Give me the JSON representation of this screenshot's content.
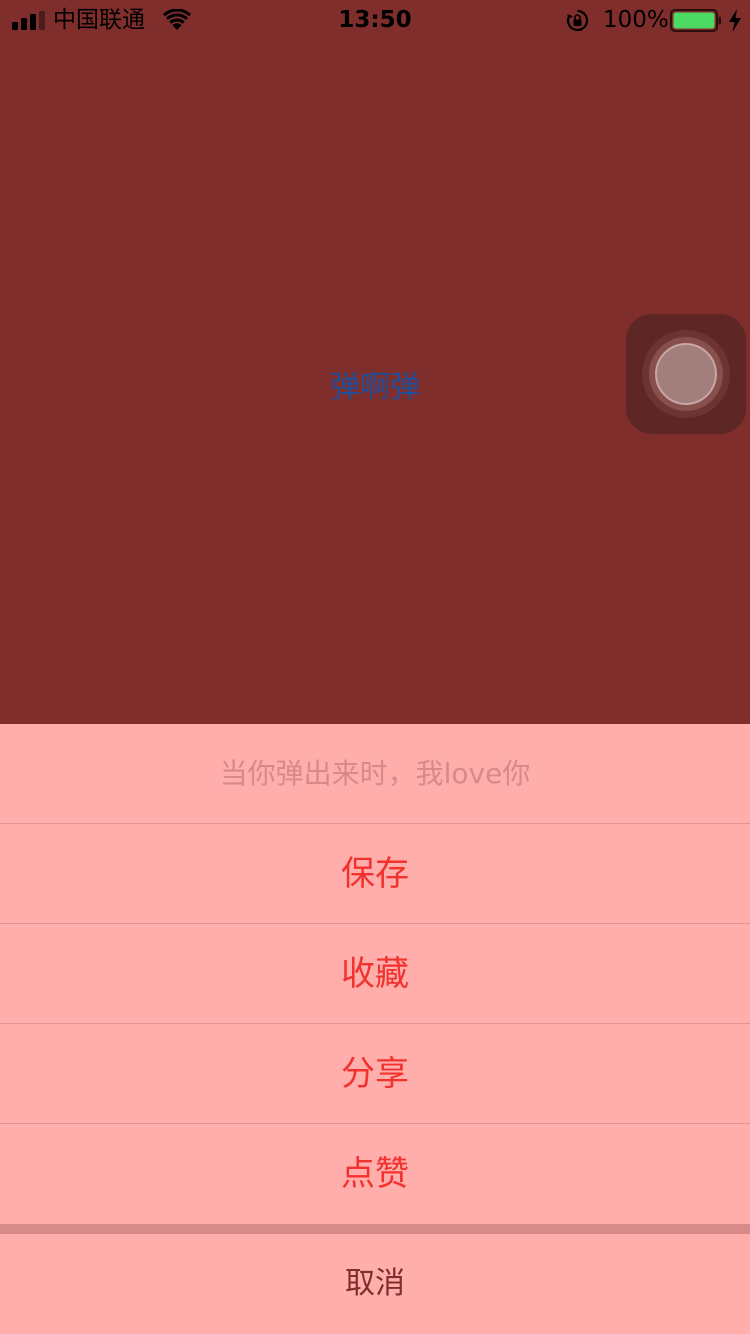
{
  "status_bar": {
    "carrier": "中国联通",
    "time": "13:50",
    "battery_percent": "100%",
    "battery_level": 1.0,
    "battery_color": "#4cd964"
  },
  "main": {
    "center_label": "弹啊弹",
    "background_color": "#7f2e2c",
    "label_color": "#1f4f9a"
  },
  "action_sheet": {
    "title": "当你弹出来时，我love你",
    "items": [
      {
        "label": "保存"
      },
      {
        "label": "收藏"
      },
      {
        "label": "分享"
      },
      {
        "label": "点赞"
      }
    ],
    "cancel_label": "取消",
    "background_color": "#ffaeab",
    "item_color": "#f2322f"
  },
  "icons": {
    "signal": "signal-bars-icon",
    "wifi": "wifi-icon",
    "lock": "orientation-lock-icon",
    "battery": "battery-icon",
    "charge": "charging-bolt-icon",
    "assistive_touch": "assistive-touch-icon"
  }
}
